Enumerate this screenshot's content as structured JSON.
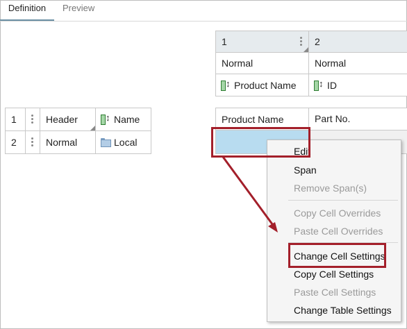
{
  "tabs": {
    "definition": "Definition",
    "preview": "Preview"
  },
  "top_grid": {
    "col1_index": "1",
    "col2_index": "2",
    "col1_style": "Normal",
    "col2_style": "Normal",
    "col1_field": "Product Name",
    "col2_field": "ID"
  },
  "left_grid": {
    "rows": [
      {
        "index": "1",
        "style": "Header",
        "field": "Name"
      },
      {
        "index": "2",
        "style": "Normal",
        "field": "Local"
      }
    ]
  },
  "table_header": {
    "col1": "Product Name",
    "col2": "Part No."
  },
  "context_menu": {
    "edit": "Edit",
    "span": "Span",
    "remove_span": "Remove Span(s)",
    "copy_overrides": "Copy Cell Overrides",
    "paste_overrides": "Paste Cell Overrides",
    "change_cell": "Change Cell Settings",
    "copy_settings": "Copy Cell Settings",
    "paste_settings": "Paste Cell Settings",
    "change_table": "Change Table Settings"
  },
  "colors": {
    "highlight": "#a31f2a",
    "selection": "#b8dcf0",
    "tab_underline": "#6a8fa3"
  },
  "icons": [
    "field-icon",
    "folder-icon",
    "grip-icon",
    "arrow-annotation"
  ]
}
